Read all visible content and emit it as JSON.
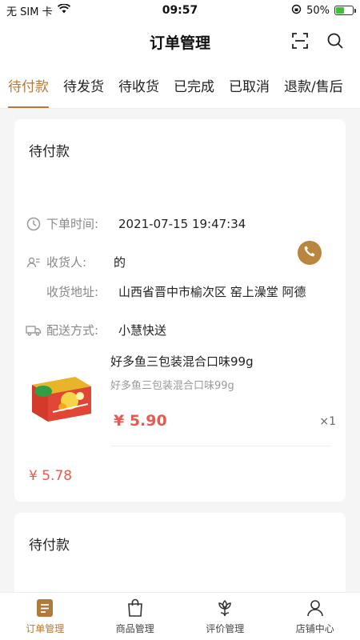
{
  "status_bar": {
    "carrier": "无 SIM 卡",
    "time": "09:57",
    "battery": "50%",
    "battery_level": 0.5
  },
  "header": {
    "title": "订单管理",
    "scan_icon": "scan-icon",
    "search_icon": "search-icon"
  },
  "tabs": [
    {
      "label": "待付款",
      "active": true
    },
    {
      "label": "待发货",
      "active": false
    },
    {
      "label": "待收货",
      "active": false
    },
    {
      "label": "已完成",
      "active": false
    },
    {
      "label": "已取消",
      "active": false
    },
    {
      "label": "退款/售后",
      "active": false
    }
  ],
  "orders": [
    {
      "status": "待付款",
      "order_time_label": "下单时间:",
      "order_time": "2021-07-15 19:47:34",
      "receiver_label": "收货人:",
      "receiver": "的",
      "address_label": "收货地址:",
      "address": "山西省晋中市榆次区 窑上澡堂 阿德",
      "delivery_label": "配送方式:",
      "delivery": "小慧快送",
      "product": {
        "name": "好多鱼三包装混合口味99g",
        "spec": "好多鱼三包装混合口味99g",
        "price": "¥ 5.90",
        "qty": "×1"
      },
      "total": "¥ 5.78"
    },
    {
      "status": "待付款"
    }
  ],
  "bottom_nav": [
    {
      "label": "订单管理",
      "icon": "orders-icon",
      "active": true
    },
    {
      "label": "商品管理",
      "icon": "bag-icon",
      "active": false
    },
    {
      "label": "评价管理",
      "icon": "flower-icon",
      "active": false
    },
    {
      "label": "店铺中心",
      "icon": "user-icon",
      "active": false
    }
  ],
  "colors": {
    "accent": "#b07a3a",
    "price": "#e85a4f",
    "phone_button": "#b8863e"
  }
}
